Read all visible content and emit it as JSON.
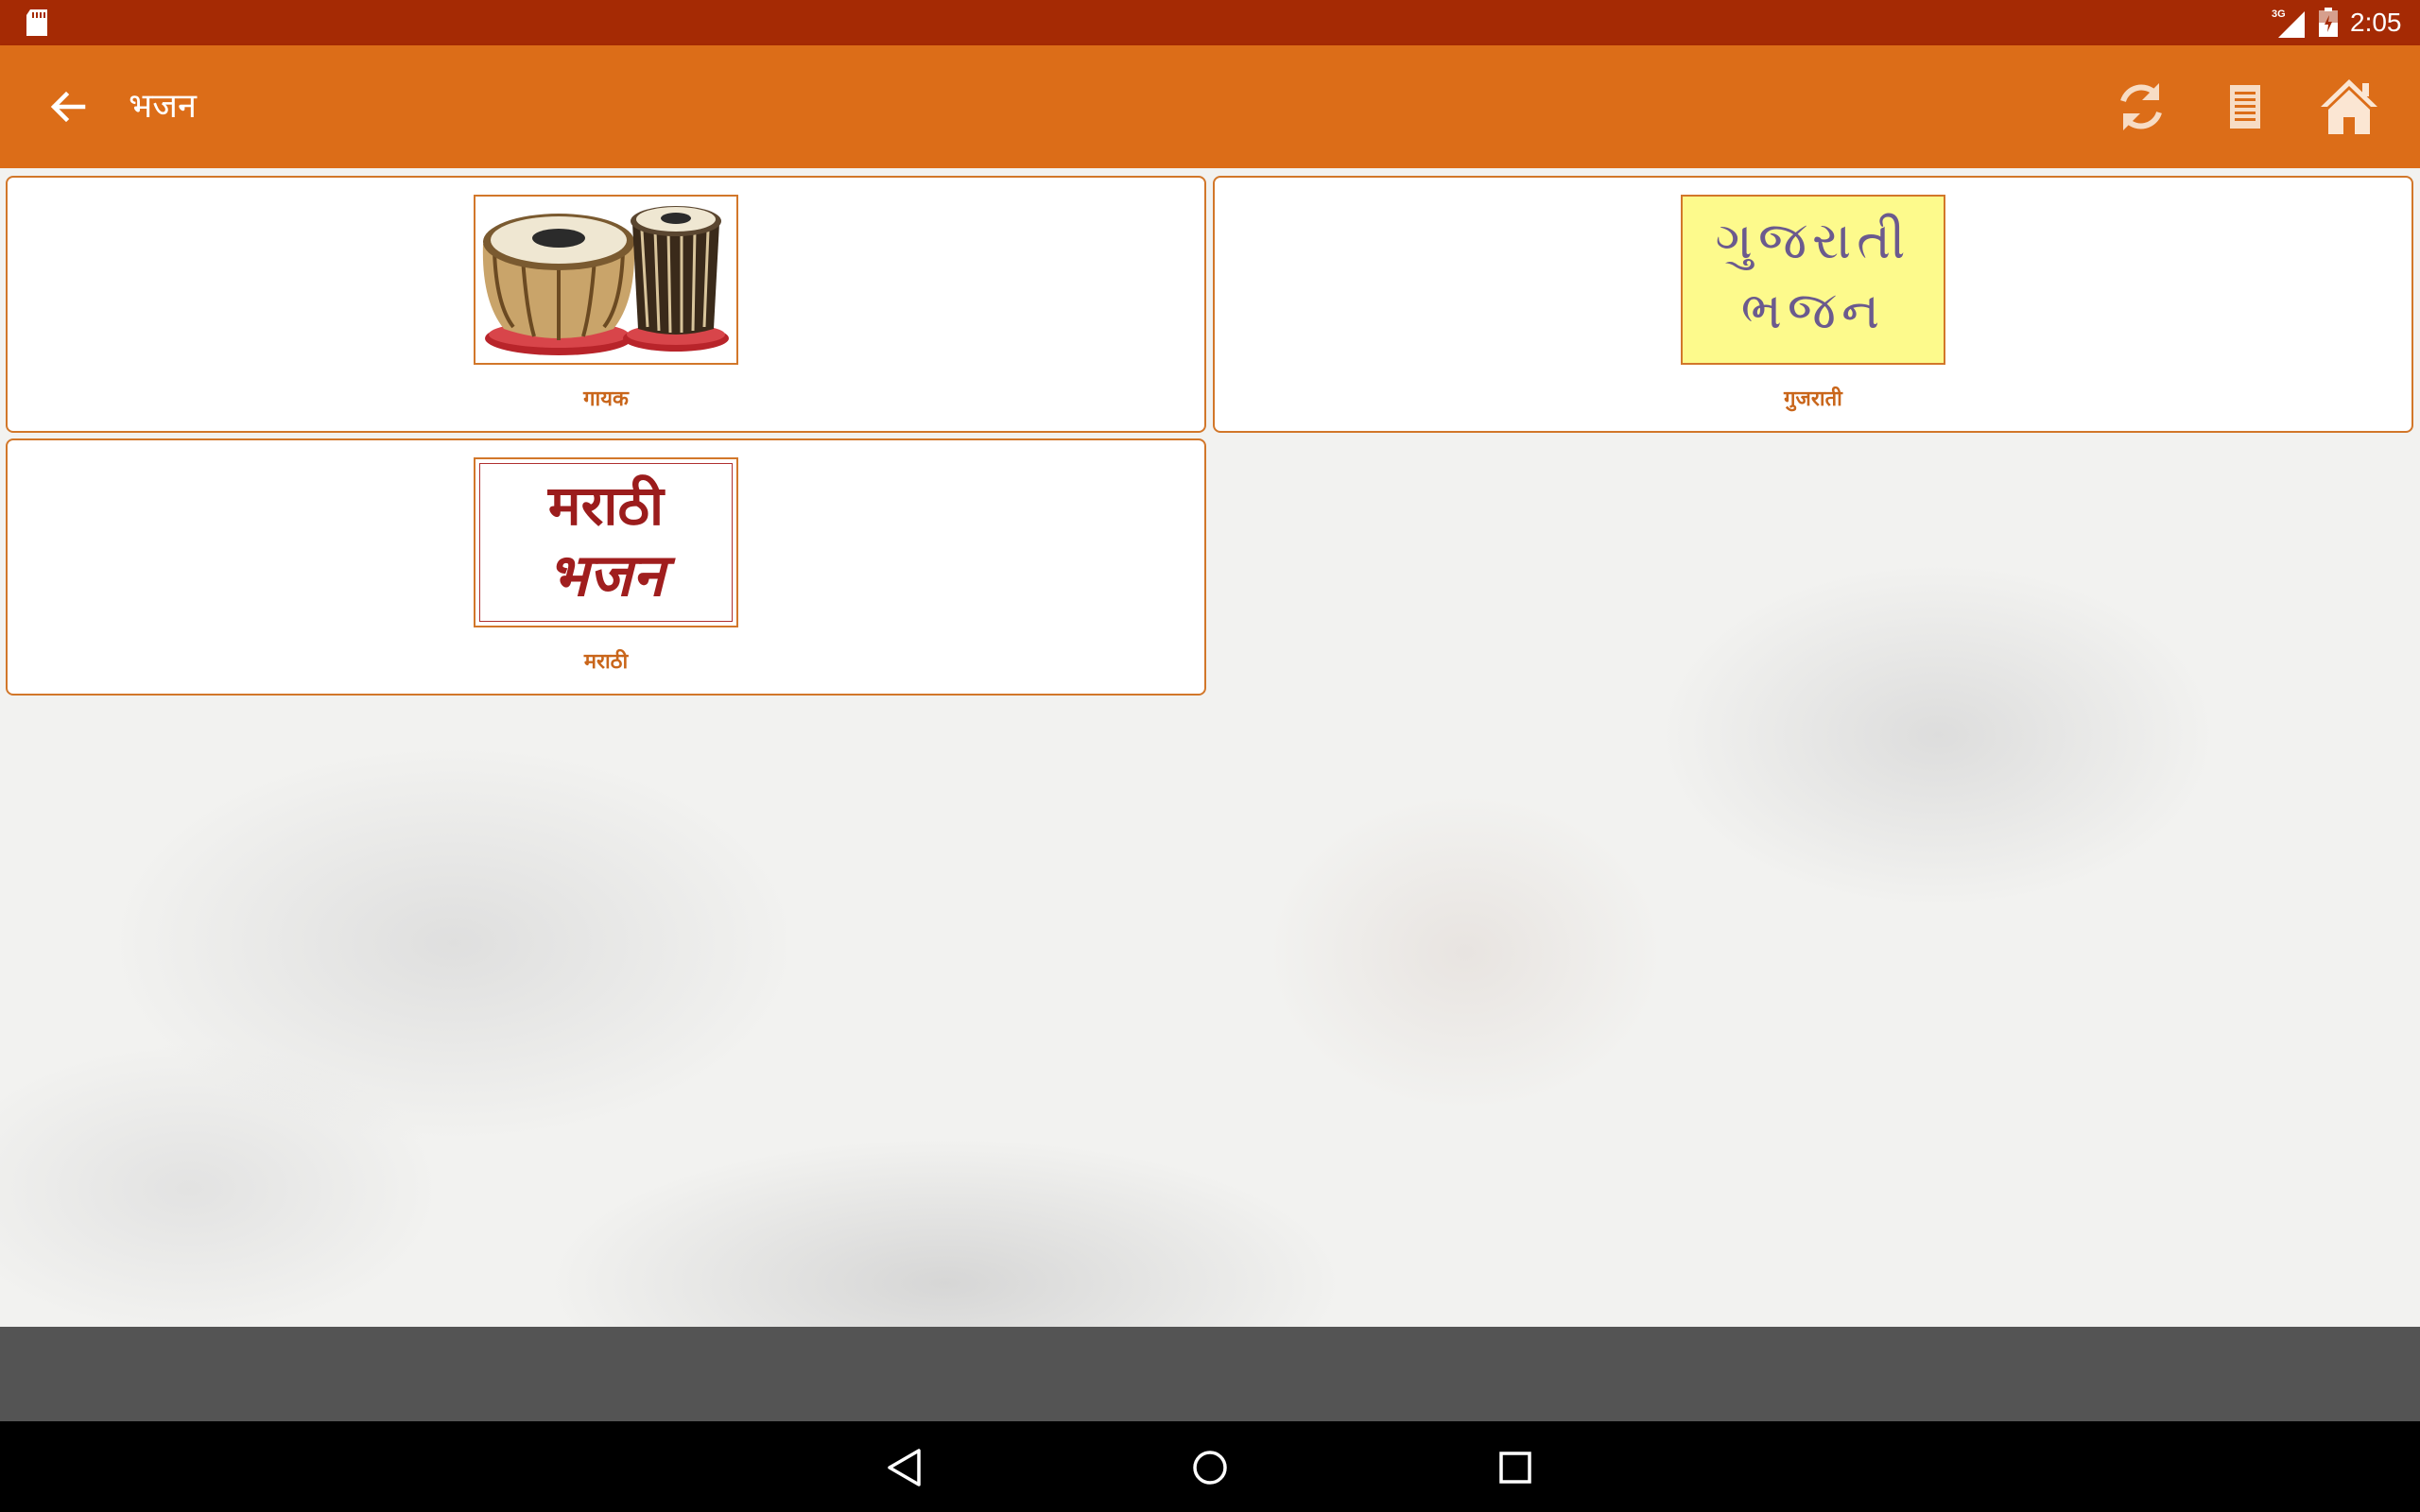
{
  "status_bar": {
    "time": "2:05",
    "network": "3G",
    "icons": [
      "sd-card-icon",
      "signal-icon",
      "battery-icon"
    ]
  },
  "app_bar": {
    "title": "भजन",
    "background": "#dc6d18",
    "icons": [
      "back-arrow-icon",
      "refresh-icon",
      "list-icon",
      "home-icon"
    ]
  },
  "categories": [
    {
      "label": "गायक",
      "image": "tabla-drums"
    },
    {
      "label": "गुजराती",
      "image": "gujarati-bhajan-text",
      "image_text": [
        "ગુજરાતી",
        "ભજન"
      ]
    },
    {
      "label": "मराठी",
      "image": "marathi-bhajan-text",
      "image_text": [
        "मराठी",
        "भजन"
      ]
    }
  ],
  "colors": {
    "status_bar": "#a52a04",
    "accent": "#dc6d18",
    "card_border": "#d2772a",
    "label": "#c9661b"
  }
}
